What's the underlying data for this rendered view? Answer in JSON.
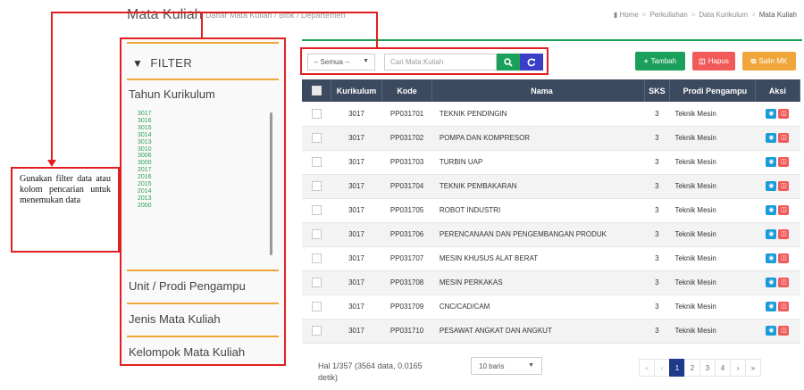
{
  "header": {
    "title": "Mata Kuliah",
    "subtitle": "Daftar Mata Kuliah / Blok / Departemen",
    "breadcrumb": [
      "Home",
      "Perkuliahan",
      "Data Kurikulum",
      "Mata Kuliah"
    ]
  },
  "sidebar": {
    "filter_label": "FILTER",
    "tahun_kurikulum": {
      "label": "Tahun Kurikulum",
      "years": [
        "3017",
        "3016",
        "3015",
        "3014",
        "3013",
        "3010",
        "3006",
        "3000",
        "2017",
        "2016",
        "2015",
        "2014",
        "2013",
        "2000"
      ]
    },
    "unit_label": "Unit / Prodi Pengampu",
    "jenis_label": "Jenis Mata Kuliah",
    "kelompok_label": "Kelompok Mata Kuliah"
  },
  "callout": {
    "text": "Gunakan filter data atau kolom pencarian untuk menemukan data"
  },
  "search": {
    "select_value": "-- Semua --",
    "placeholder": "Cari Mata Kuliah"
  },
  "actions": {
    "tambah": "Tambah",
    "hapus": "Hapus",
    "salin": "Salin MK"
  },
  "table": {
    "headers": {
      "kurikulum": "Kurikulum",
      "kode": "Kode",
      "nama": "Nama",
      "sks": "SKS",
      "prodi": "Prodi Pengampu",
      "aksi": "Aksi"
    },
    "rows": [
      {
        "kurikulum": "3017",
        "kode": "PP031701",
        "nama": "TEKNIK PENDINGIN",
        "sks": "3",
        "prodi": "Teknik Mesin"
      },
      {
        "kurikulum": "3017",
        "kode": "PP031702",
        "nama": "POMPA DAN KOMPRESOR",
        "sks": "3",
        "prodi": "Teknik Mesin"
      },
      {
        "kurikulum": "3017",
        "kode": "PP031703",
        "nama": "TURBIN UAP",
        "sks": "3",
        "prodi": "Teknik Mesin"
      },
      {
        "kurikulum": "3017",
        "kode": "PP031704",
        "nama": "TEKNIK PEMBAKARAN",
        "sks": "3",
        "prodi": "Teknik Mesin"
      },
      {
        "kurikulum": "3017",
        "kode": "PP031705",
        "nama": "ROBOT INDUSTRI",
        "sks": "3",
        "prodi": "Teknik Mesin"
      },
      {
        "kurikulum": "3017",
        "kode": "PP031706",
        "nama": "PERENCANAAN DAN PENGEMBANGAN PRODUK",
        "sks": "3",
        "prodi": "Teknik Mesin"
      },
      {
        "kurikulum": "3017",
        "kode": "PP031707",
        "nama": "MESIN KHUSUS ALAT BERAT",
        "sks": "3",
        "prodi": "Teknik Mesin"
      },
      {
        "kurikulum": "3017",
        "kode": "PP031708",
        "nama": "MESIN PERKAKAS",
        "sks": "3",
        "prodi": "Teknik Mesin"
      },
      {
        "kurikulum": "3017",
        "kode": "PP031709",
        "nama": "CNC/CAD/CAM",
        "sks": "3",
        "prodi": "Teknik Mesin"
      },
      {
        "kurikulum": "3017",
        "kode": "PP031710",
        "nama": "PESAWAT ANGKAT DAN ANGKUT",
        "sks": "3",
        "prodi": "Teknik Mesin"
      }
    ]
  },
  "footer": {
    "info": "Hal 1/357 (3564 data, 0.0165 detik)",
    "per_page": "10 baris",
    "pages": [
      "«",
      "‹",
      "1",
      "2",
      "3",
      "4",
      "›",
      "»"
    ],
    "current_page": "1"
  },
  "colors": {
    "accent_green": "#1aa05a",
    "highlight_red": "#e02020",
    "table_header": "#3b4a5e",
    "section_orange": "#f0a63a"
  }
}
